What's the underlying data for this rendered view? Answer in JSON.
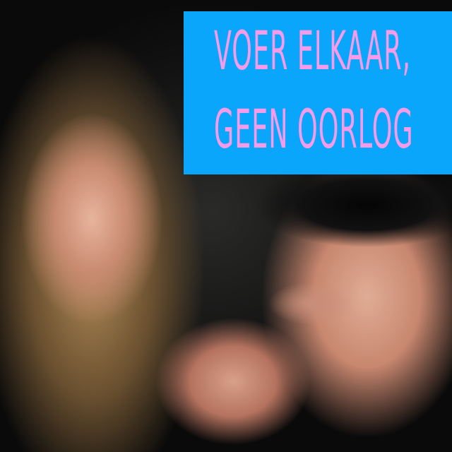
{
  "banner": {
    "line1": "VOER ELKAAR,",
    "line2": "GEEN OORLOG",
    "background_color": "#0aa6fb",
    "text_color": "#f59be8"
  },
  "photo": {
    "subject": "two women, one blindfolded being fed a snack"
  }
}
